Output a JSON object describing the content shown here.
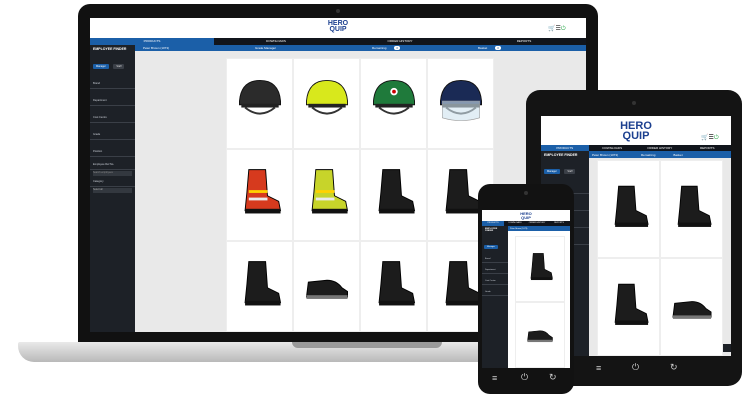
{
  "brand": {
    "line1": "HERO",
    "line2": "QUIP"
  },
  "nav": {
    "tabs": [
      "PRODUCTS",
      "DOWNLOADS",
      "ORDER HISTORY",
      "REPORTS"
    ]
  },
  "toolbar": {
    "user": "Peter Brown (1073)",
    "role": "Grade Manager",
    "remaining_label": "Remaining",
    "remaining_count": "0",
    "basket_label": "Basket",
    "basket_count": "0"
  },
  "sidebar": {
    "title": "EMPLOYEE FINDER",
    "btn_primary": "Manager",
    "btn_secondary": "Staff",
    "fields": [
      "Brand",
      "Department",
      "Cost Centre",
      "Grade",
      "Position",
      "Employee Ref No.",
      "Category"
    ],
    "placeholder": "Search employees",
    "select_value": "Select all"
  },
  "products": [
    {
      "icon": "helmet-black-icon",
      "color": "#2b2b2b"
    },
    {
      "icon": "helmet-yellow-icon",
      "color": "#d8e81c"
    },
    {
      "icon": "helmet-green-icon",
      "color": "#1f7a3b"
    },
    {
      "icon": "helmet-navy-visor-icon",
      "color": "#1a2a55"
    },
    {
      "icon": "boot-fire-red-icon",
      "color": "#d63a1e"
    },
    {
      "icon": "boot-fire-yellow-icon",
      "color": "#c7d42a"
    },
    {
      "icon": "boot-black-tall-icon",
      "color": "#1c1c1c"
    },
    {
      "icon": "boot-black-lace-icon",
      "color": "#1c1c1c"
    },
    {
      "icon": "boot-black-hiker-icon",
      "color": "#1c1c1c"
    },
    {
      "icon": "shoe-black-grey-icon",
      "color": "#1c1c1c"
    },
    {
      "icon": "boot-black-mid-icon",
      "color": "#1c1c1c"
    },
    {
      "icon": "boot-black-high-icon",
      "color": "#1c1c1c"
    }
  ],
  "colors": {
    "brand_blue": "#1b3f8f",
    "accent": "#1b5fa8",
    "dark": "#11151c"
  }
}
